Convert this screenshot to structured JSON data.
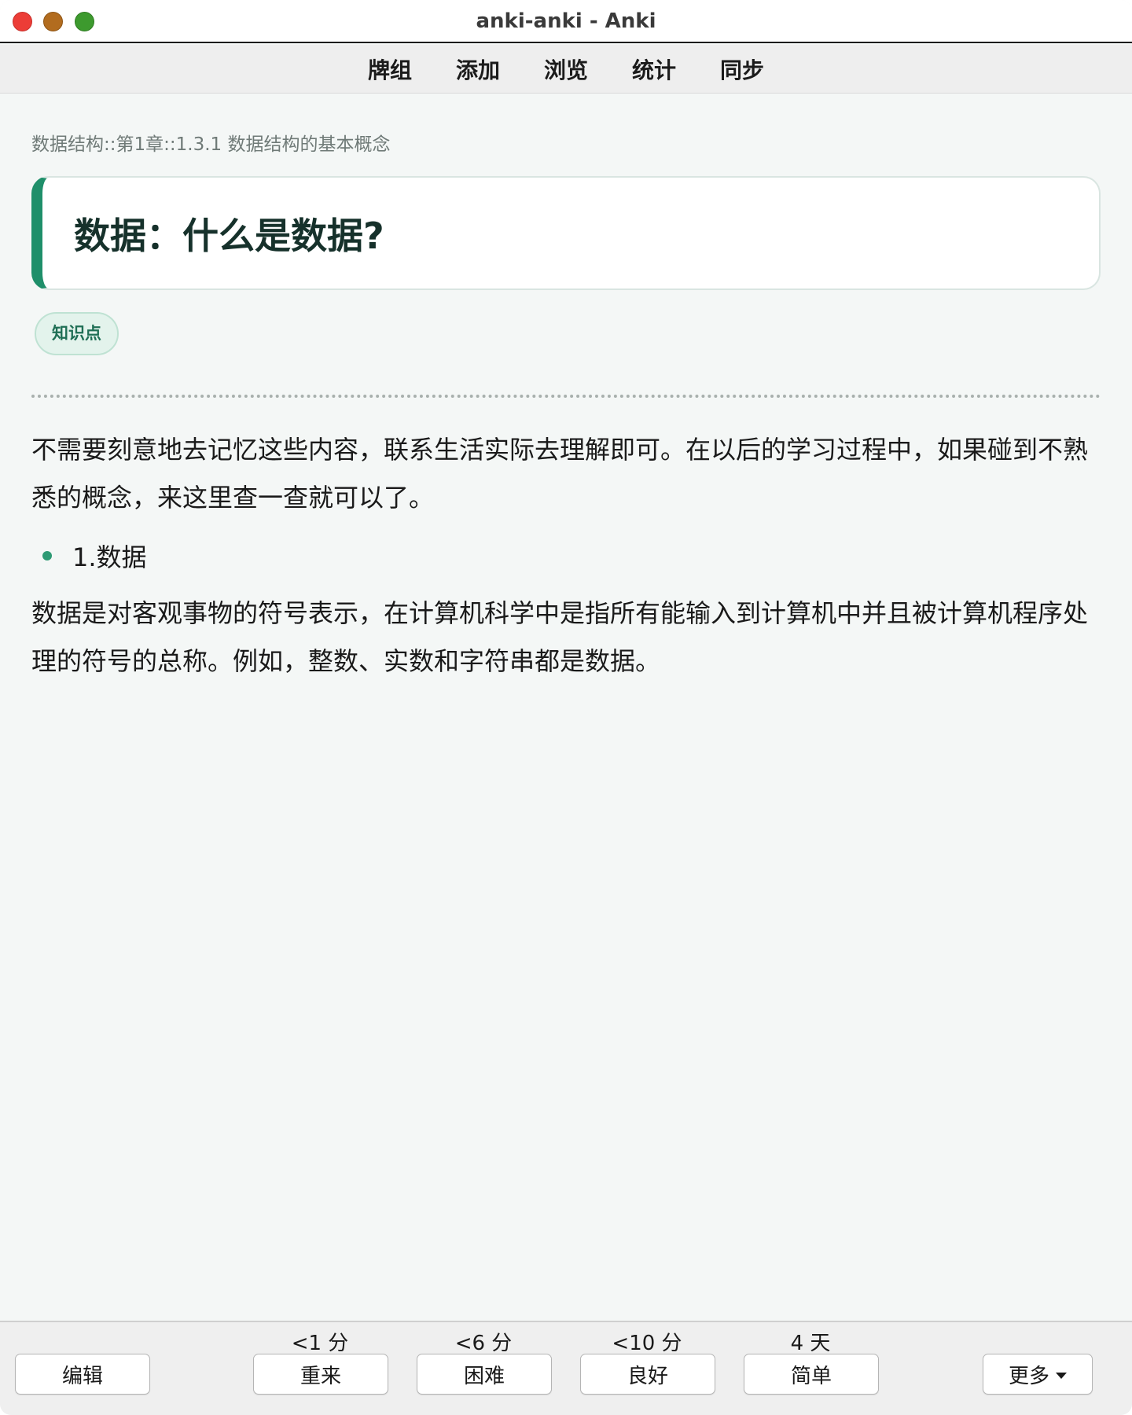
{
  "window": {
    "title": "anki-anki - Anki"
  },
  "toolbar": {
    "tabs": [
      "牌组",
      "添加",
      "浏览",
      "统计",
      "同步"
    ]
  },
  "card": {
    "breadcrumb": "数据结构::第1章::1.3.1 数据结构的基本概念",
    "title": "数据：什么是数据?",
    "tag": "知识点",
    "paragraph1": "不需要刻意地去记忆这些内容，联系生活实际去理解即可。在以后的学习过程中，如果碰到不熟悉的概念，来这里查一查就可以了。",
    "bullet": "1.数据",
    "paragraph2": "数据是对客观事物的符号表示，在计算机科学中是指所有能输入到计算机中并且被计算机程序处理的符号的总称。例如，整数、实数和字符串都是数据。",
    "accent_color": "#1f8f6a"
  },
  "bottom": {
    "edit_label": "编辑",
    "more_label": "更多",
    "answers": [
      {
        "interval": "<1 分",
        "label": "重来"
      },
      {
        "interval": "<6 分",
        "label": "困难"
      },
      {
        "interval": "<10 分",
        "label": "良好"
      },
      {
        "interval": "4 天",
        "label": "简单"
      }
    ]
  }
}
